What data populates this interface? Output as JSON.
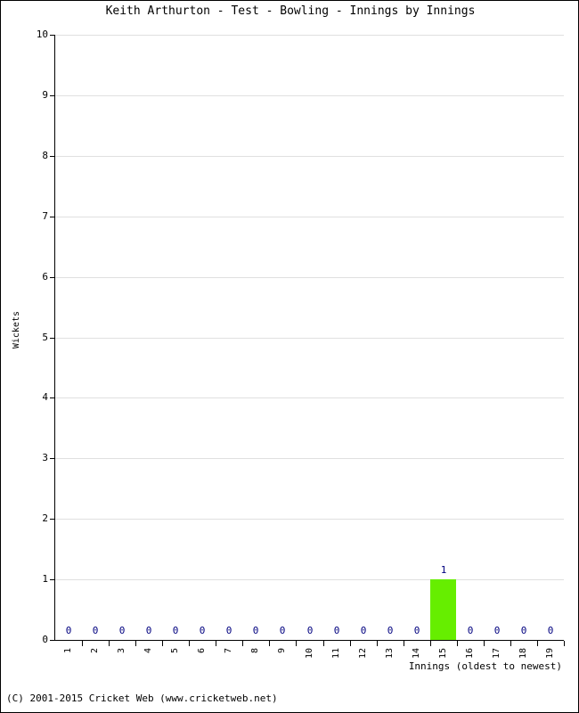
{
  "title": "Keith Arthurton - Test - Bowling - Innings by Innings",
  "footer": "(C) 2001-2015 Cricket Web (www.cricketweb.net)",
  "colors": {
    "bar": "#66ee00",
    "value_label": "#00007f",
    "gridline": "#e0e0e0",
    "axis": "#000000",
    "background": "#ffffff"
  },
  "chart_data": {
    "type": "bar",
    "title": "Keith Arthurton - Test - Bowling - Innings by Innings",
    "xlabel": "Innings (oldest to newest)",
    "ylabel": "Wickets",
    "categories": [
      "1",
      "2",
      "3",
      "4",
      "5",
      "6",
      "7",
      "8",
      "9",
      "10",
      "11",
      "12",
      "13",
      "14",
      "15",
      "16",
      "17",
      "18",
      "19"
    ],
    "values": [
      0,
      0,
      0,
      0,
      0,
      0,
      0,
      0,
      0,
      0,
      0,
      0,
      0,
      0,
      1,
      0,
      0,
      0,
      0
    ],
    "value_labels": [
      "0",
      "0",
      "0",
      "0",
      "0",
      "0",
      "0",
      "0",
      "0",
      "0",
      "0",
      "0",
      "0",
      "0",
      "1",
      "0",
      "0",
      "0",
      "0"
    ],
    "ylim": [
      0,
      10
    ],
    "yticks": [
      0,
      1,
      2,
      3,
      4,
      5,
      6,
      7,
      8,
      9,
      10
    ],
    "ytick_labels": [
      "0",
      "1",
      "2",
      "3",
      "4",
      "5",
      "6",
      "7",
      "8",
      "9",
      "10"
    ],
    "grid": true,
    "grid_axis": "y",
    "legend": false,
    "series": [
      {
        "name": "Wickets",
        "color": "#66ee00",
        "values": [
          0,
          0,
          0,
          0,
          0,
          0,
          0,
          0,
          0,
          0,
          0,
          0,
          0,
          0,
          1,
          0,
          0,
          0,
          0
        ]
      }
    ]
  }
}
